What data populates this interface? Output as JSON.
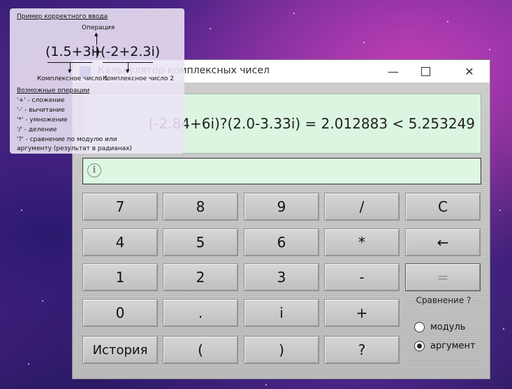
{
  "window": {
    "title": "Калькулятор комплексных чисел",
    "minimize": "—",
    "close": "✕"
  },
  "display": {
    "expression": "(-2.84+6i)?(2.0-3.33i) = 2.012883 < 5.253249"
  },
  "info": {
    "icon": "info-icon",
    "text": ""
  },
  "keys": {
    "k7": "7",
    "k8": "8",
    "k9": "9",
    "div": "/",
    "clear": "C",
    "k4": "4",
    "k5": "5",
    "k6": "6",
    "mul": "*",
    "back": "←",
    "k1": "1",
    "k2": "2",
    "k3": "3",
    "sub": "-",
    "eq": "=",
    "k0": "0",
    "dot": ".",
    "imag": "i",
    "add": "+",
    "history": "История",
    "lparen": "(",
    "rparen": ")",
    "cmp": "?"
  },
  "compare": {
    "title": "Сравнение ?",
    "options": [
      {
        "label": "модуль",
        "checked": false
      },
      {
        "label": "аргумент",
        "checked": true
      }
    ]
  },
  "help": {
    "heading": "Пример корректного ввода",
    "operation_label": "Операция",
    "example_left": "(1.5+3i)",
    "example_op": "+",
    "example_right": "(-2+2.3i)",
    "number1_label": "Комплексное число 1",
    "number2_label": "Комплексное число 2",
    "ops_heading": "Возможные операции",
    "ops": [
      "'+' - сложение",
      "'-' - вычитание",
      "'*' - умножение",
      "'/' - деление",
      "'?' - сравнение по модулю или",
      "аргументу (результат в радианах)"
    ]
  },
  "colors": {
    "display_bg": "#dcf5e1",
    "button_face": "#c9c9c9",
    "help_bg": "#ece4f5"
  }
}
